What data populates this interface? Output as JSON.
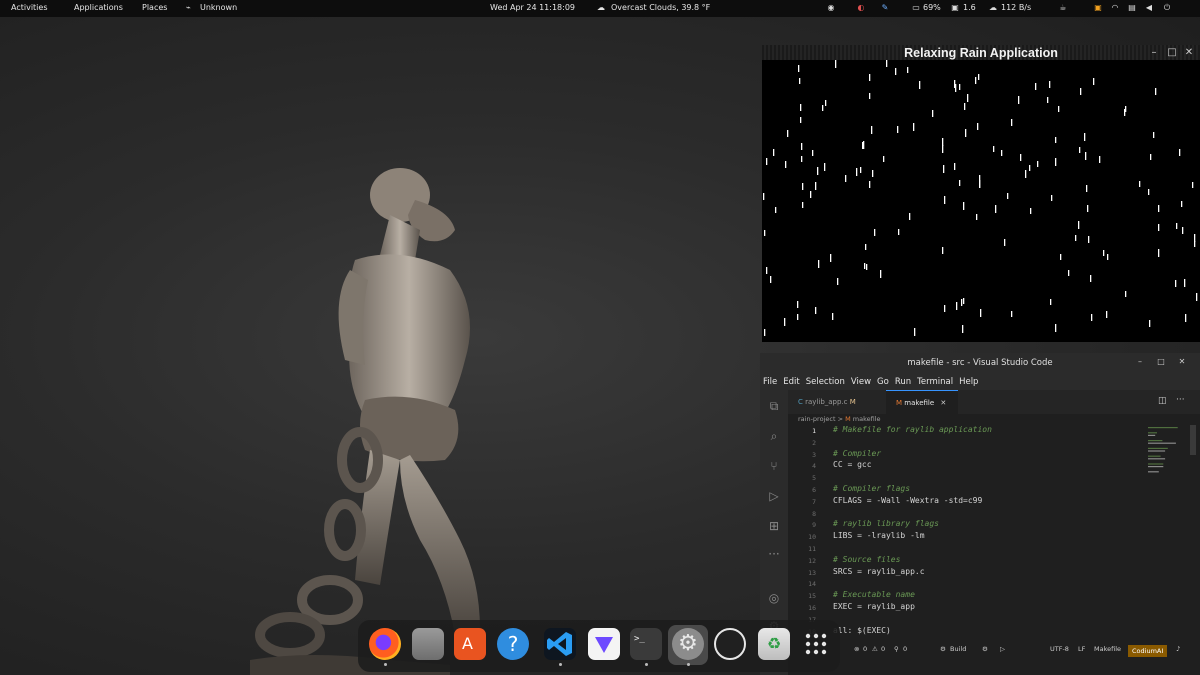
{
  "topbar": {
    "activities": "Activities",
    "applications": "Applications",
    "places": "Places",
    "network_status": "Unknown",
    "datetime": "Wed Apr 24  11:18:09",
    "weather": "Overcast Clouds, 39.8 °F",
    "battery": "69%",
    "cpu": "1.6",
    "net_speed": "112 B/s",
    "icons": [
      "network-activity-icon",
      "weather-cloud-icon",
      "extension-icon",
      "firefox-sync-icon",
      "pencil-icon",
      "battery-icon",
      "cpu-monitor-icon",
      "cloud-upload-icon",
      "coffee-icon",
      "screenshot-icon",
      "wifi-icon",
      "vpn-icon",
      "volume-icon",
      "power-icon"
    ]
  },
  "rain_window": {
    "title": "Relaxing Rain Application"
  },
  "vscode": {
    "title": "makefile - src - Visual Studio Code",
    "menu": [
      "File",
      "Edit",
      "Selection",
      "View",
      "Go",
      "Run",
      "Terminal",
      "Help"
    ],
    "tabs": [
      {
        "label": "raylib_app.c",
        "suffix": "M",
        "icon": "C"
      },
      {
        "label": "makefile",
        "suffix": "",
        "icon": "M"
      }
    ],
    "breadcrumb": {
      "folder": "rain-project",
      "sep": ">",
      "file": "makefile"
    },
    "lines": [
      {
        "n": "1",
        "text": "# Makefile for raylib application",
        "kind": "comment"
      },
      {
        "n": "2",
        "text": "",
        "kind": "text"
      },
      {
        "n": "3",
        "text": "# Compiler",
        "kind": "comment"
      },
      {
        "n": "4",
        "text": "CC = gcc",
        "kind": "text"
      },
      {
        "n": "5",
        "text": "",
        "kind": "text"
      },
      {
        "n": "6",
        "text": "# Compiler flags",
        "kind": "comment"
      },
      {
        "n": "7",
        "text": "CFLAGS = -Wall -Wextra -std=c99",
        "kind": "text"
      },
      {
        "n": "8",
        "text": "",
        "kind": "text"
      },
      {
        "n": "9",
        "text": "# raylib library flags",
        "kind": "comment"
      },
      {
        "n": "10",
        "text": "LIBS = -lraylib -lm",
        "kind": "text"
      },
      {
        "n": "11",
        "text": "",
        "kind": "text"
      },
      {
        "n": "12",
        "text": "# Source files",
        "kind": "comment"
      },
      {
        "n": "13",
        "text": "SRCS = raylib_app.c",
        "kind": "text"
      },
      {
        "n": "14",
        "text": "",
        "kind": "text"
      },
      {
        "n": "15",
        "text": "# Executable name",
        "kind": "comment"
      },
      {
        "n": "16",
        "text": "EXEC = raylib_app",
        "kind": "text"
      },
      {
        "n": "17",
        "text": "",
        "kind": "text"
      },
      {
        "n": "18",
        "text": "all: $(EXEC)",
        "kind": "text"
      }
    ],
    "status": {
      "errors": "0",
      "warnings": "0",
      "ports": "0",
      "build": "Build",
      "encoding": "UTF-8",
      "eol": "LF",
      "language": "Makefile",
      "codium": "CodiumAI"
    }
  },
  "dock": {
    "apps": [
      "firefox-icon",
      "files-icon",
      "app-center-icon",
      "help-icon",
      "vscode-icon",
      "proton-vpn-icon",
      "terminal-icon",
      "settings-icon",
      "obs-icon",
      "trash-icon",
      "show-apps-icon"
    ]
  }
}
